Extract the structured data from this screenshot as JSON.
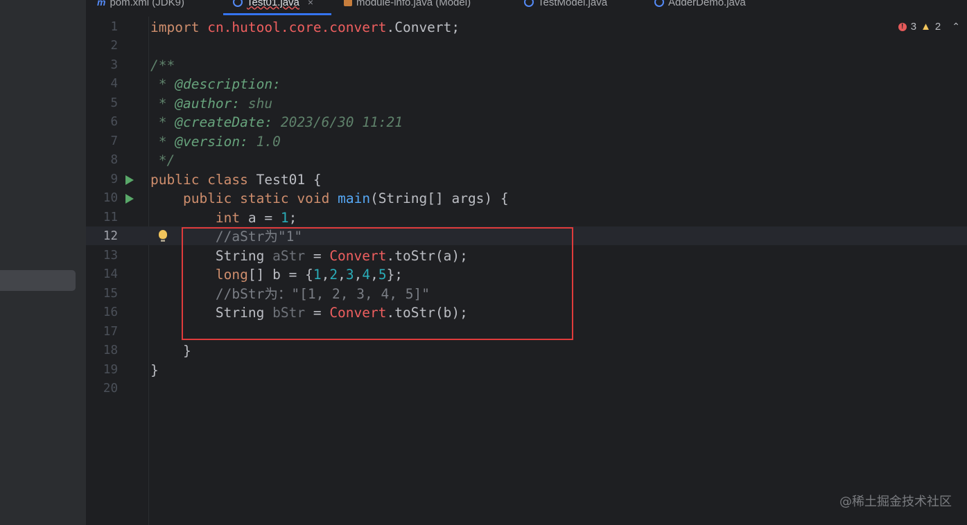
{
  "tabs": [
    {
      "icon": "maven-icon",
      "label": "pom.xml (JDK9)",
      "active": false
    },
    {
      "icon": "class-icon",
      "label": "Test01.java",
      "active": true
    },
    {
      "icon": "module-icon",
      "label": "module-info.java (Model)",
      "active": false
    },
    {
      "icon": "class-icon",
      "label": "TestModel.java",
      "active": false
    },
    {
      "icon": "class-icon",
      "label": "AdderDemo.java",
      "active": false
    }
  ],
  "tab_close": "×",
  "inspections": {
    "errors": "3",
    "warnings": "2",
    "error_icon": "!",
    "warning_icon": "▲",
    "collapse": "⌃"
  },
  "current_line": "12",
  "lines": [
    {
      "n": "1",
      "tokens": [
        [
          "import",
          "kw"
        ],
        [
          " ",
          ""
        ],
        [
          "cn.hutool.core.convert",
          "pk"
        ],
        [
          ".Convert;",
          ""
        ]
      ]
    },
    {
      "n": "2",
      "tokens": []
    },
    {
      "n": "3",
      "tokens": [
        [
          "/**",
          "doc"
        ]
      ]
    },
    {
      "n": "4",
      "tokens": [
        [
          " * ",
          "doc"
        ],
        [
          "@description:",
          "tag"
        ]
      ]
    },
    {
      "n": "5",
      "tokens": [
        [
          " * ",
          "doc"
        ],
        [
          "@author:",
          "tag"
        ],
        [
          " shu",
          "doc"
        ]
      ]
    },
    {
      "n": "6",
      "tokens": [
        [
          " * ",
          "doc"
        ],
        [
          "@createDate:",
          "tag"
        ],
        [
          " 2023/6/30 11:21",
          "doc"
        ]
      ]
    },
    {
      "n": "7",
      "tokens": [
        [
          " * ",
          "doc"
        ],
        [
          "@version:",
          "tag"
        ],
        [
          " 1.0",
          "doc"
        ]
      ]
    },
    {
      "n": "8",
      "tokens": [
        [
          " */",
          "doc"
        ]
      ]
    },
    {
      "n": "9",
      "run": true,
      "tokens": [
        [
          "public",
          "kw"
        ],
        [
          " ",
          ""
        ],
        [
          "class",
          "kw"
        ],
        [
          " Test01 {",
          ""
        ]
      ]
    },
    {
      "n": "10",
      "run": true,
      "tokens": [
        [
          "    ",
          ""
        ],
        [
          "public",
          "kw"
        ],
        [
          " ",
          ""
        ],
        [
          "static",
          "kw"
        ],
        [
          " ",
          ""
        ],
        [
          "void",
          "kw"
        ],
        [
          " ",
          ""
        ],
        [
          "main",
          "fn"
        ],
        [
          "(String[] args) {",
          ""
        ]
      ]
    },
    {
      "n": "11",
      "tokens": [
        [
          "        ",
          ""
        ],
        [
          "int",
          "kw"
        ],
        [
          " a = ",
          ""
        ],
        [
          "1",
          "num"
        ],
        [
          ";",
          ""
        ]
      ]
    },
    {
      "n": "12",
      "bulb": true,
      "tokens": [
        [
          "        ",
          ""
        ],
        [
          "//aStr为\"1\"",
          "cm"
        ]
      ]
    },
    {
      "n": "13",
      "tokens": [
        [
          "        String ",
          ""
        ],
        [
          "aStr",
          "unused"
        ],
        [
          " = ",
          ""
        ],
        [
          "Convert",
          "cl"
        ],
        [
          ".toStr(a);",
          ""
        ]
      ]
    },
    {
      "n": "14",
      "tokens": [
        [
          "        ",
          ""
        ],
        [
          "long",
          "kw"
        ],
        [
          "[] b = {",
          ""
        ],
        [
          "1",
          "num"
        ],
        [
          ",",
          ""
        ],
        [
          "2",
          "num"
        ],
        [
          ",",
          ""
        ],
        [
          "3",
          "num"
        ],
        [
          ",",
          ""
        ],
        [
          "4",
          "num"
        ],
        [
          ",",
          ""
        ],
        [
          "5",
          "num"
        ],
        [
          "};",
          ""
        ]
      ]
    },
    {
      "n": "15",
      "tokens": [
        [
          "        ",
          ""
        ],
        [
          "//bStr为：\"[1, 2, 3, 4, 5]\"",
          "cm"
        ]
      ]
    },
    {
      "n": "16",
      "tokens": [
        [
          "        String ",
          ""
        ],
        [
          "bStr",
          "unused"
        ],
        [
          " = ",
          ""
        ],
        [
          "Convert",
          "cl"
        ],
        [
          ".toStr(b);",
          ""
        ]
      ]
    },
    {
      "n": "17",
      "tokens": []
    },
    {
      "n": "18",
      "tokens": [
        [
          "    }",
          ""
        ]
      ]
    },
    {
      "n": "19",
      "tokens": [
        [
          "}",
          ""
        ]
      ]
    },
    {
      "n": "20",
      "tokens": []
    }
  ],
  "watermark": "@稀土掘金技术社区",
  "colors": {
    "highlight_box": "#e03b3b",
    "accent": "#3574f0"
  }
}
